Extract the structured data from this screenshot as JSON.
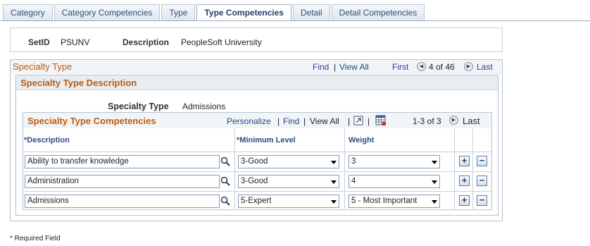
{
  "tabs": [
    "Category",
    "Category Competencies",
    "Type",
    "Type Competencies",
    "Detail",
    "Detail Competencies"
  ],
  "header": {
    "setid_label": "SetID",
    "setid_value": "PSUNV",
    "description_label": "Description",
    "description_value": "PeopleSoft University"
  },
  "specialty_type_box": {
    "title": "Specialty Type",
    "find": "Find",
    "sep": "|",
    "view_all": "View All",
    "first": "First",
    "counter": "4 of 46",
    "last": "Last"
  },
  "description_section": {
    "title": "Specialty Type Description",
    "specialty_type_label": "Specialty Type",
    "specialty_type_value": "Admissions"
  },
  "competencies_grid": {
    "title": "Specialty Type Competencies",
    "personalize": "Personalize",
    "find": "Find",
    "view_all": "View All",
    "sep": "|",
    "counter": "1-3 of 3",
    "last": "Last",
    "columns": {
      "description": "*Description",
      "min_level": "*Minimum Level",
      "weight": "Weight"
    },
    "rows": [
      {
        "description": "Ability to transfer knowledge",
        "min_level": "3-Good",
        "weight": "3"
      },
      {
        "description": "Administration",
        "min_level": "3-Good",
        "weight": "4"
      },
      {
        "description": "Admissions",
        "min_level": "5-Expert",
        "weight": "5 - Most Important"
      }
    ],
    "add_symbol": "+",
    "remove_symbol": "−"
  },
  "footer": {
    "required_note": "* Required Field"
  },
  "icons": {
    "lookup": "magnifier-icon",
    "prev": "left-arrow-icon",
    "next": "right-arrow-icon",
    "zoom": "zoom-grid-icon",
    "download": "download-spreadsheet-icon"
  },
  "colors": {
    "accent_orange": "#c05a0b",
    "link_blue": "#1f4a85",
    "tab_blue": "#2c4e7a"
  }
}
